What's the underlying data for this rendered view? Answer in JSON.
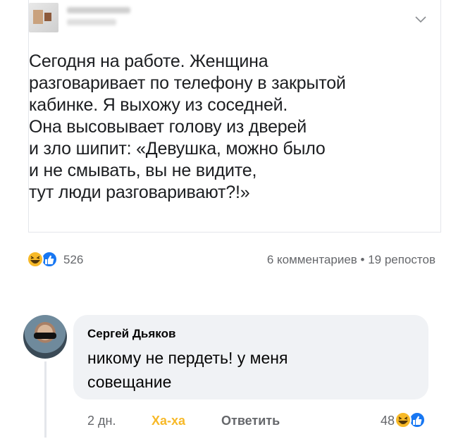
{
  "post": {
    "text_lines": [
      "Сегодня на работе. Женщина",
      "разговаривает по телефону в закрытой",
      "кабинке. Я выхожу из соседней.",
      "Она высовывает голову из дверей",
      "и зло шипит: «Девушка, можно было",
      "и не смывать, вы не видите,",
      "тут люди разговаривают?!»"
    ],
    "menu_icon": "chevron-down-icon"
  },
  "stats": {
    "reaction_icons": [
      "haha-icon",
      "like-icon"
    ],
    "reactions_count": "526",
    "comments_shares": "6 комментариев • 19 репостов"
  },
  "comment": {
    "author": "Сергей Дьяков",
    "text_lines": [
      "никому не пердеть! у меня",
      "совещание"
    ],
    "time": "2 дн.",
    "reaction_label": "Ха-ха",
    "reply_label": "Ответить",
    "reactions_count": "48",
    "reaction_icons": [
      "haha-icon",
      "like-icon"
    ]
  },
  "colors": {
    "haha": "#f7b928",
    "like": "#1877f2",
    "bubble": "#f0f2f5",
    "muted": "#65676b"
  }
}
